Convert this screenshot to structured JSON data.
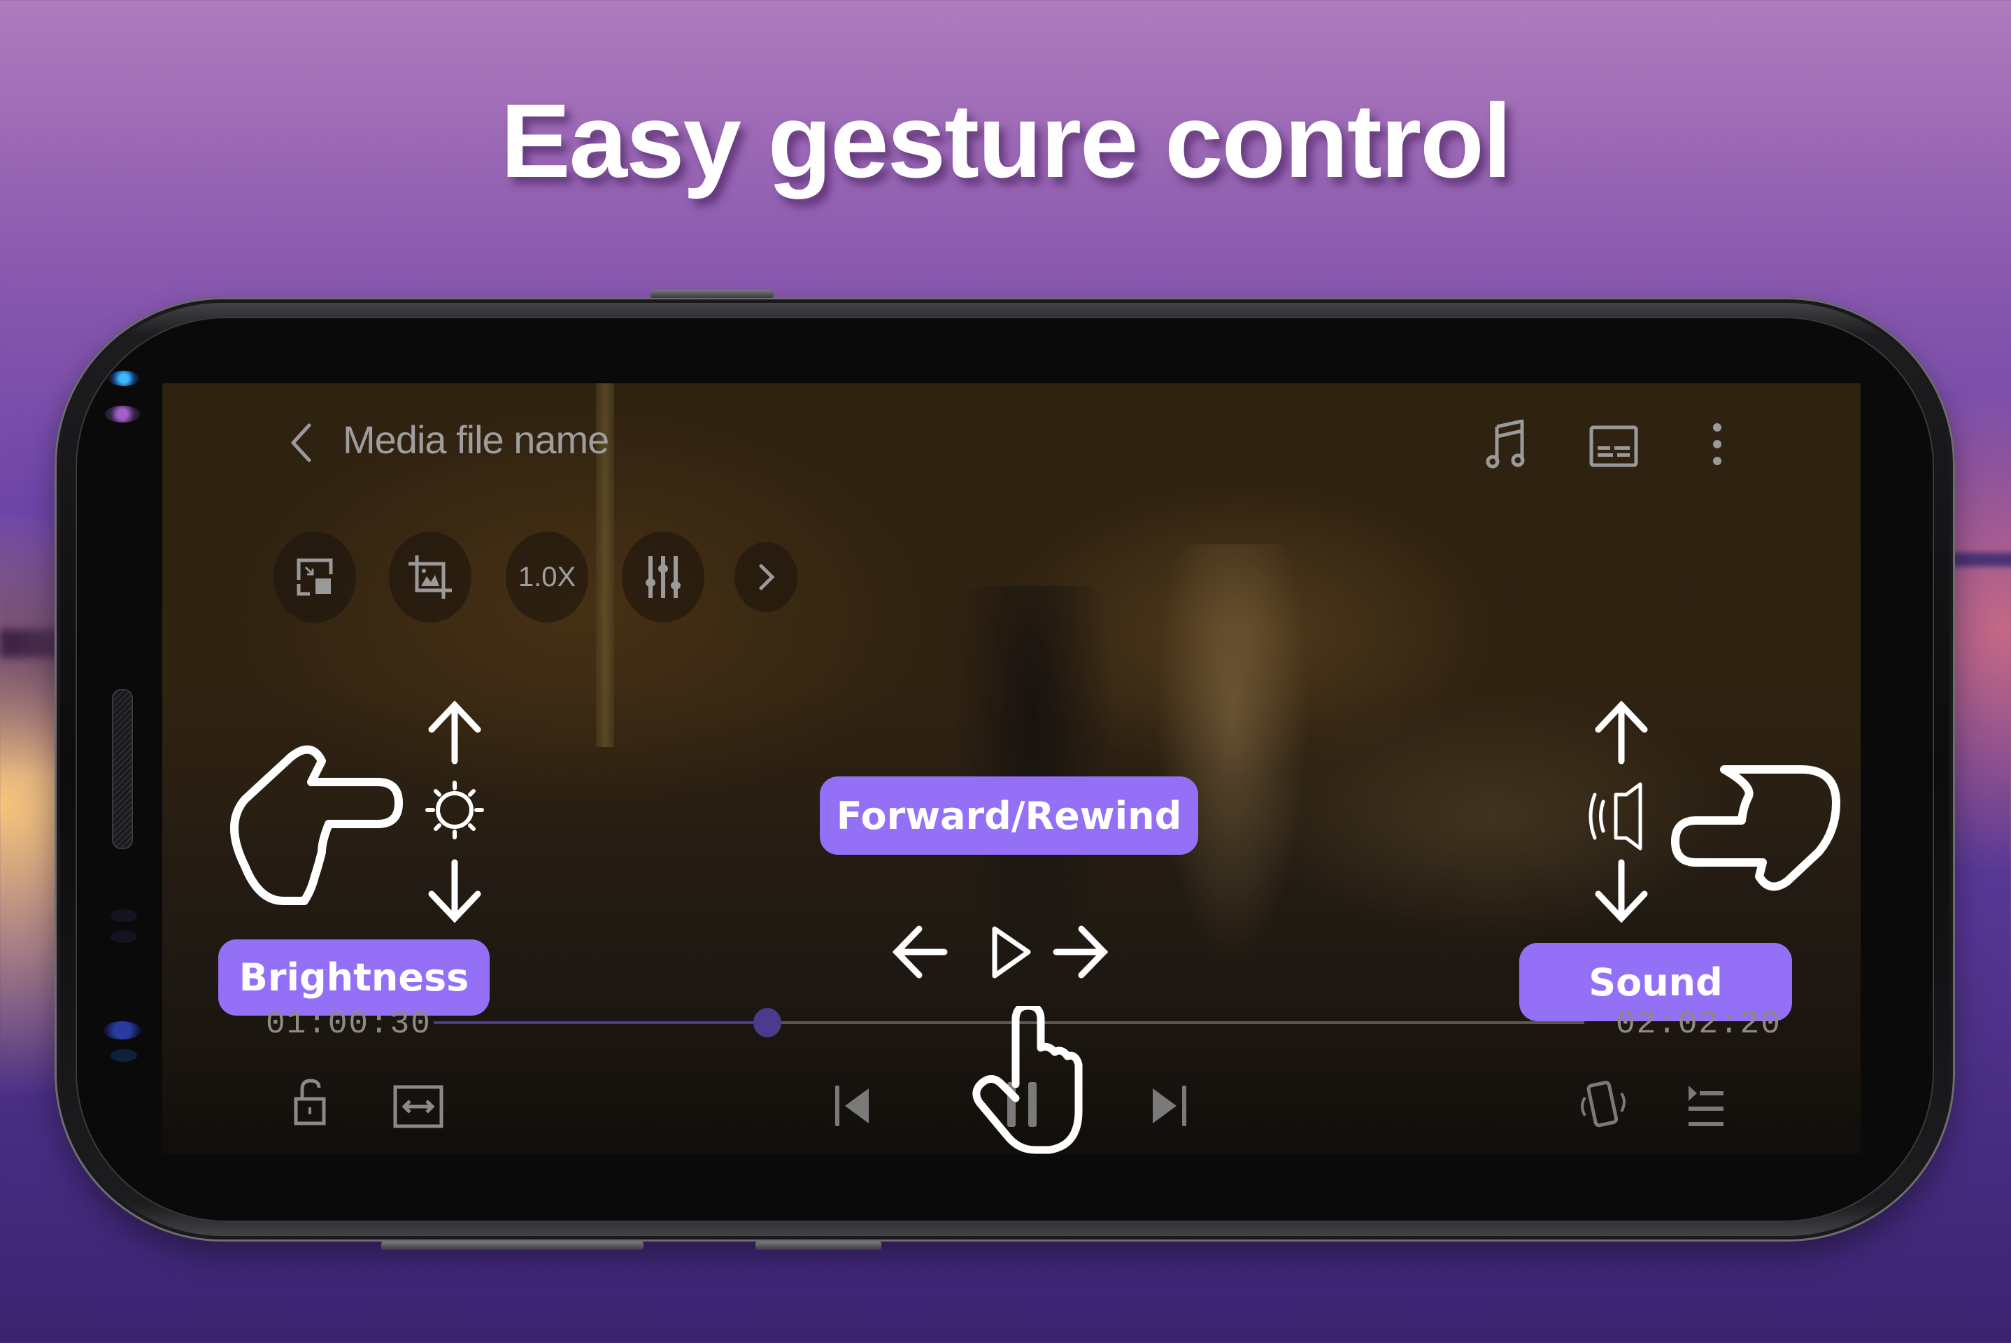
{
  "headline": "Easy gesture control",
  "player": {
    "media_title": "Media file name",
    "top_icons": [
      "back-icon",
      "music-note-icon",
      "subtitles-icon",
      "more-vertical-icon"
    ],
    "toolbar": {
      "buttons": [
        "pop-up-play-icon",
        "crop-screen-icon",
        "speed",
        "equalizer-icon",
        "expand-more-icon"
      ],
      "speed_label": "1.0X"
    },
    "time_current": "01:00:30",
    "time_total": "02:02:20",
    "progress": 0.29,
    "bottom_controls": [
      "unlock-icon",
      "aspect-ratio-icon",
      "previous-icon",
      "pause-icon",
      "next-icon",
      "auto-rotate-icon",
      "playlist-icon"
    ]
  },
  "gestures": {
    "brightness": {
      "label": "Brightness",
      "icon": "sun-icon"
    },
    "seek": {
      "label": "Forward/Rewind",
      "icon": "play-icon"
    },
    "sound": {
      "label": "Sound",
      "icon": "speaker-icon"
    }
  },
  "colors": {
    "accent_pill": "#9370f6",
    "progress": "#4a3b8f",
    "ui_icon_gray": "#9a9a9a",
    "gesture_white": "#ffffff"
  }
}
